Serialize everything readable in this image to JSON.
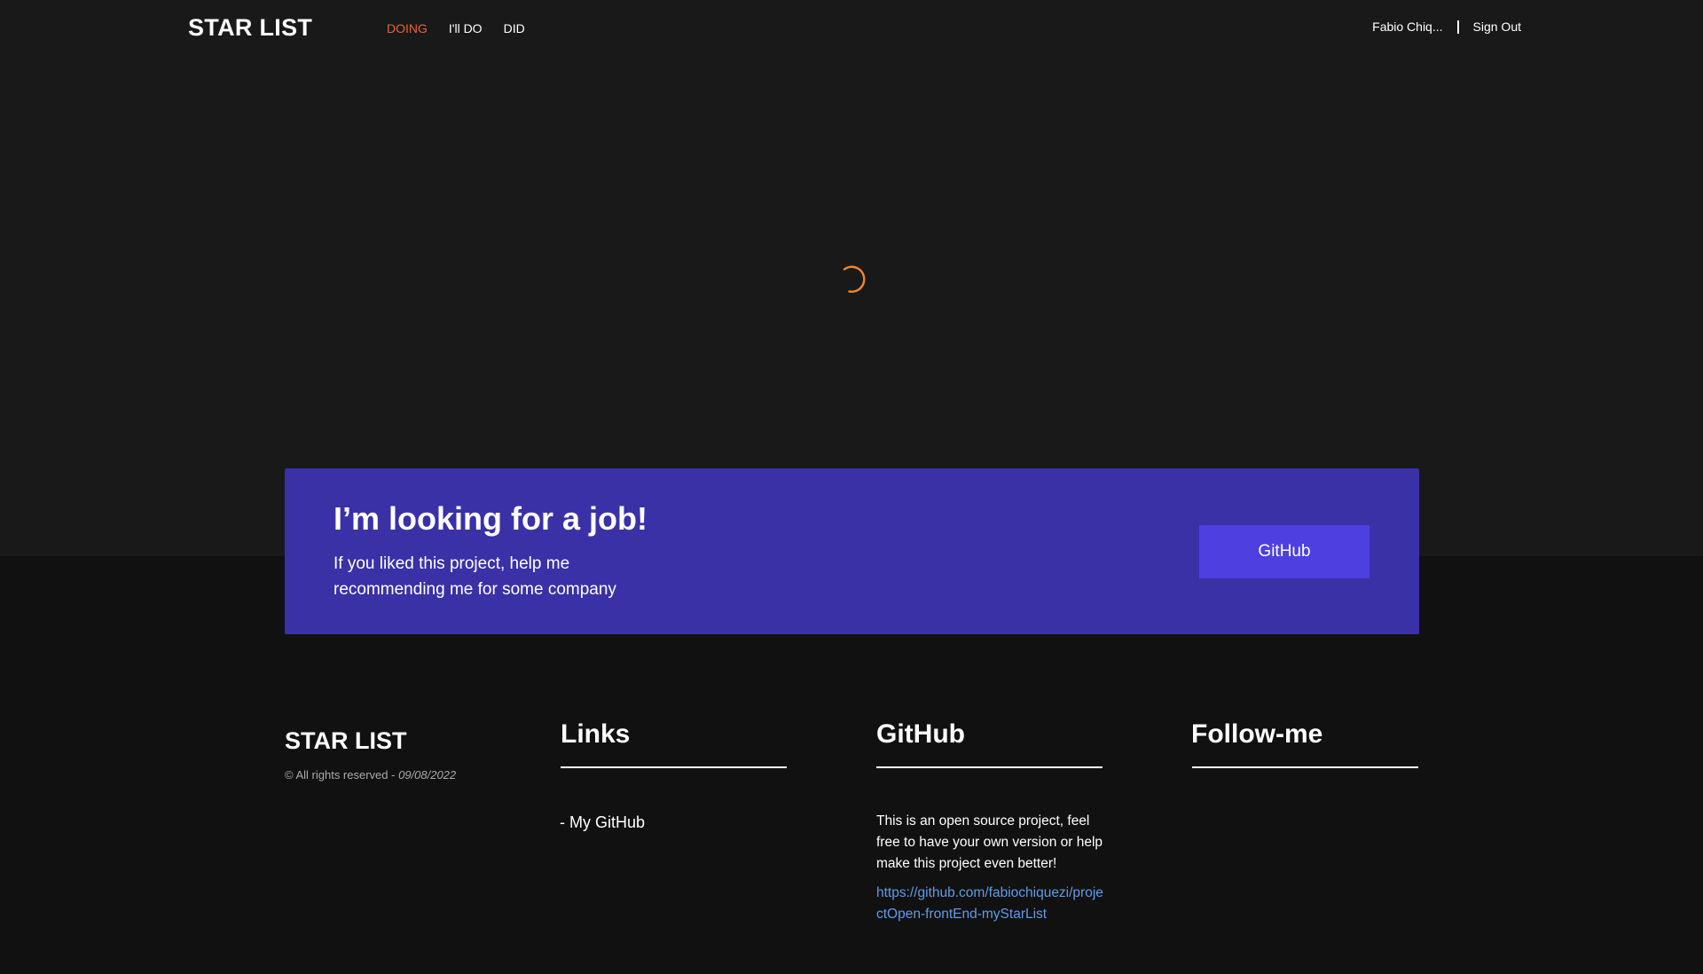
{
  "header": {
    "brand": "STAR LIST",
    "nav": [
      {
        "label": "DOING",
        "active": true
      },
      {
        "label": "I'll DO",
        "active": false
      },
      {
        "label": "DID",
        "active": false
      }
    ],
    "user_name": "Fabio Chiq...",
    "sign_out": "Sign Out"
  },
  "loading": {
    "spinner_icon": "loading-spinner-icon",
    "color": "#f0832d"
  },
  "banner": {
    "title": "I’m looking for a job!",
    "text": "If you liked this project, help me recommending me for some company",
    "button": "GitHub",
    "background": "#3a31a7",
    "button_color": "#4e40e0"
  },
  "footer": {
    "brand": "STAR LIST",
    "copyright": "© All rights reserved - ",
    "date": "09/08/2022",
    "links_title": "Links",
    "links": [
      "- My GitHub"
    ],
    "github_title": "GitHub",
    "github_desc": "This is an open source project, feel free to have your own version or help make this project even better!",
    "github_url": "https://github.com/fabiochiquezi/projectOpen-frontEnd-myStarList",
    "follow_title": "Follow-me"
  },
  "colors": {
    "accent": "#e8632a",
    "link": "#5d9de8",
    "background": "#191919",
    "footer_background": "#111111"
  }
}
